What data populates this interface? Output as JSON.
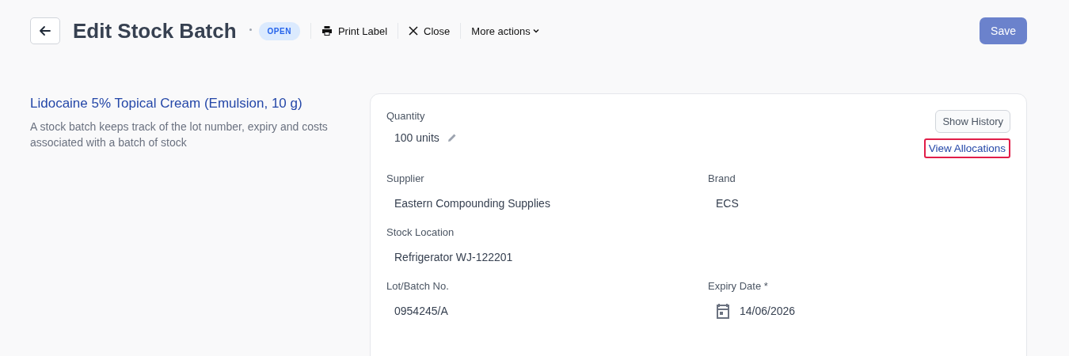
{
  "header": {
    "title": "Edit Stock Batch",
    "status": "OPEN",
    "actions": [
      {
        "label": "Print Label",
        "kind": "print"
      },
      {
        "label": "Close",
        "kind": "close"
      },
      {
        "label": "More actions",
        "kind": "menu"
      }
    ],
    "save": "Save"
  },
  "intro": {
    "product": "Lidocaine 5% Topical Cream",
    "form": "(Emulsion, 10 g)",
    "description": "A stock batch keeps track of the lot number, expiry and costs associated with a batch of stock"
  },
  "quantity": {
    "label": "Quantity",
    "value": "100 units"
  },
  "history_button": "Show History",
  "allocations_link": {
    "label": "View Allocations",
    "focused": true
  },
  "rows": [
    [
      {
        "label": "Supplier",
        "value": "Eastern Compounding Supplies",
        "kind": "text"
      },
      {
        "label": "Brand",
        "value": "ECS",
        "kind": "text"
      }
    ],
    [
      {
        "label": "Stock Location",
        "value": "Refrigerator WJ-122201",
        "kind": "text"
      }
    ],
    [
      {
        "label": "Lot/Batch No.",
        "value": "0954245/A",
        "kind": "text"
      },
      {
        "label": "Expiry Date *",
        "value": "14/06/2026",
        "kind": "date"
      }
    ]
  ]
}
